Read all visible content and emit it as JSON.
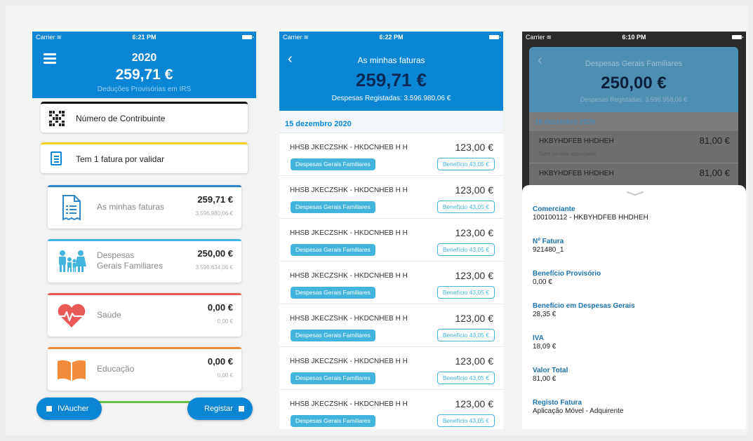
{
  "phone1": {
    "status": {
      "carrier": "Carrier",
      "time": "6:21 PM"
    },
    "year": "2020",
    "total": "259,71 €",
    "subtitle": "Deduções Provisórias em IRS",
    "contrib_label": "Número de Contribuinte",
    "pending_label": "Tem 1 fatura por validar",
    "categories": [
      {
        "label": "As minhas faturas",
        "amount": "259,71 €",
        "sub": "3.596.980,06 €",
        "color": "#2f86c8",
        "icon": "invoice-icon"
      },
      {
        "label": "Despesas\nGerais Familiares",
        "amount": "250,00 €",
        "sub": "3.596.634,06 €",
        "color": "#42b4dd",
        "icon": "family-icon"
      },
      {
        "label": "Saúde",
        "amount": "0,00 €",
        "sub": "0,00 €",
        "color": "#e85a57",
        "icon": "heart-icon"
      },
      {
        "label": "Educação",
        "amount": "0,00 €",
        "sub": "0,00 €",
        "color": "#f28c3b",
        "icon": "book-icon"
      }
    ],
    "ivaucher_label": "IVAucher",
    "registar_label": "Registar"
  },
  "phone2": {
    "status": {
      "carrier": "Carrier",
      "time": "6:22 PM"
    },
    "title": "As minhas faturas",
    "total": "259,71 €",
    "subtitle": "Despesas Registadas: 3.596.980,06 €",
    "date": "15 dezembro 2020",
    "invoices": [
      {
        "name": "HHSB JKECZSHK - HKDCNHEB H H",
        "amount": "123,00 €",
        "category": "Despesas Gerais Familiares",
        "benefit": "Benefício 43,05 €"
      },
      {
        "name": "HHSB JKECZSHK - HKDCNHEB H H",
        "amount": "123,00 €",
        "category": "Despesas Gerais Familiares",
        "benefit": "Benefício 43,05 €"
      },
      {
        "name": "HHSB JKECZSHK - HKDCNHEB H H",
        "amount": "123,00 €",
        "category": "Despesas Gerais Familiares",
        "benefit": "Benefício 43,05 €"
      },
      {
        "name": "HHSB JKECZSHK - HKDCNHEB H H",
        "amount": "123,00 €",
        "category": "Despesas Gerais Familiares",
        "benefit": "Benefício 43,05 €"
      },
      {
        "name": "HHSB JKECZSHK - HKDCNHEB H H",
        "amount": "123,00 €",
        "category": "Despesas Gerais Familiares",
        "benefit": "Benefício 43,05 €"
      },
      {
        "name": "HHSB JKECZSHK - HKDCNHEB H H",
        "amount": "123,00 €",
        "category": "Despesas Gerais Familiares",
        "benefit": "Benefício 43,05 €"
      },
      {
        "name": "HHSB JKECZSHK - HKDCNHEB H H",
        "amount": "123,00 €",
        "category": "Despesas Gerais Familiares",
        "benefit": "Benefício 43,05 €"
      }
    ]
  },
  "phone3": {
    "status": {
      "carrier": "Carrier",
      "time": "6:10 PM"
    },
    "title": "Despesas Gerais Familiares",
    "total": "250,00 €",
    "subtitle": "Despesas Registadas: 3.596.958,06 €",
    "date": "16 dezembro 2020",
    "items": [
      {
        "name": "HKBYHDFEB HHDHEH",
        "amount": "81,00 €",
        "hint": "Sem receita associada"
      },
      {
        "name": "HKBYHDFEB HHDHEH",
        "amount": "81,00 €",
        "hint": ""
      }
    ],
    "details": [
      {
        "label": "Comerciante",
        "value": "100100112 - HKBYHDFEB HHDHEH"
      },
      {
        "label": "Nº Fatura",
        "value": "921480_1"
      },
      {
        "label": "Benefício Provisório",
        "value": "0,00 €"
      },
      {
        "label": "Benefício em Despesas Gerais",
        "value": "28,35 €"
      },
      {
        "label": "IVA",
        "value": "18,09 €"
      },
      {
        "label": "Valor Total",
        "value": "81,00 €"
      },
      {
        "label": "Registo Fatura",
        "value": "Aplicação Móvel - Adquirente"
      }
    ]
  }
}
